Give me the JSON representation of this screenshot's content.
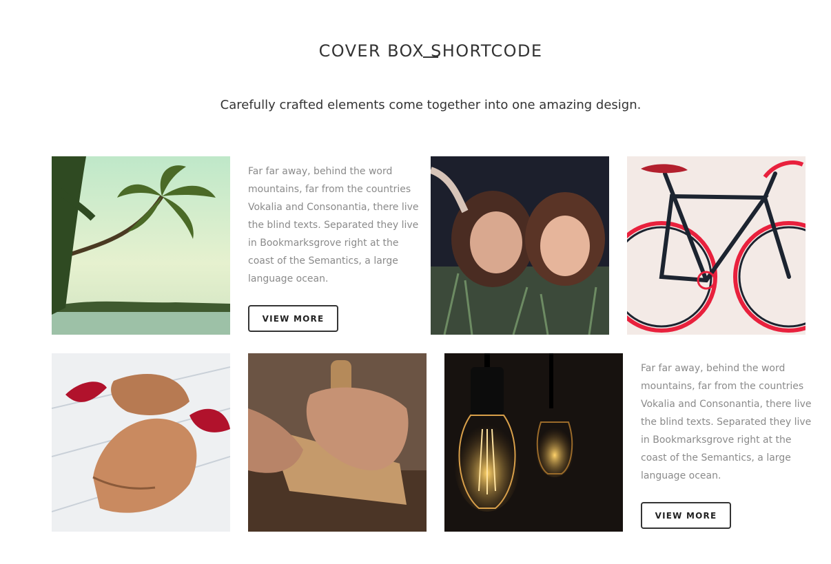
{
  "header": {
    "title": "COVER BOX SHORTCODE",
    "subtitle": "Carefully crafted elements come together into one amazing design."
  },
  "row1": {
    "text": "Far far away, behind the word mountains, far from the countries Vokalia and Consonantia, there live the blind texts. Separated they live in Bookmarksgrove right at the coast of the Semantics, a large language ocean.",
    "button": "VIEW MORE"
  },
  "row2": {
    "text": "Far far away, behind the word mountains, far from the countries Vokalia and Consonantia, there live the blind texts. Separated they live in Bookmarksgrove right at the coast of the Semantics, a large language ocean.",
    "button": "VIEW MORE"
  },
  "colors": {
    "text": "#333333",
    "muted": "#8a8a8a",
    "bike_rim": "#e8213d"
  }
}
